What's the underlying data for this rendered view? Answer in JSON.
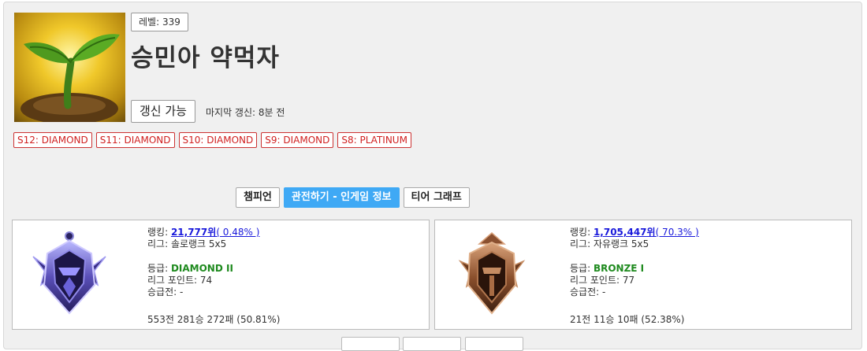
{
  "profile": {
    "level": "레벨: 339",
    "name": "승민아 약먹자",
    "refresh_label": "갱신 가능",
    "last_update": "마지막 갱신: 8분 전",
    "avatar_icon": "sprout-icon"
  },
  "seasons": [
    {
      "label": "S12: DIAMOND"
    },
    {
      "label": "S11: DIAMOND"
    },
    {
      "label": "S10: DIAMOND"
    },
    {
      "label": "S9: DIAMOND"
    },
    {
      "label": "S8: PLATINUM"
    }
  ],
  "tabs": [
    {
      "label": "챔피언",
      "active": false
    },
    {
      "label": "관전하기 - 인게임 정보",
      "active": true
    },
    {
      "label": "티어 그래프",
      "active": false
    }
  ],
  "ranks": {
    "solo": {
      "ranking_prefix": "랭킹: ",
      "ranking_value": "21,777위",
      "ranking_percent": "( 0.48% )",
      "league": "리그: 솔로랭크 5x5",
      "tier_prefix": "등급: ",
      "tier_value": "DIAMOND II",
      "league_points": "리그 포인트: 74",
      "promotion": "승급전: -",
      "record": "553전 281승 272패 (50.81%)",
      "emblem_icon": "diamond-emblem-icon"
    },
    "flex": {
      "ranking_prefix": "랭킹: ",
      "ranking_value": "1,705,447위",
      "ranking_percent": "( 70.3% )",
      "league": "리그: 자유랭크 5x5",
      "tier_prefix": "등급: ",
      "tier_value": "BRONZE I",
      "league_points": "리그 포인트: 77",
      "promotion": "승급전: -",
      "record": "21전 11승 10패 (52.38%)",
      "emblem_icon": "bronze-emblem-icon"
    }
  },
  "colors": {
    "accent_tab": "#3fa9f5",
    "season_red": "#d02020",
    "tier_green": "#1e8a1e",
    "link_blue": "#1a1adb"
  }
}
